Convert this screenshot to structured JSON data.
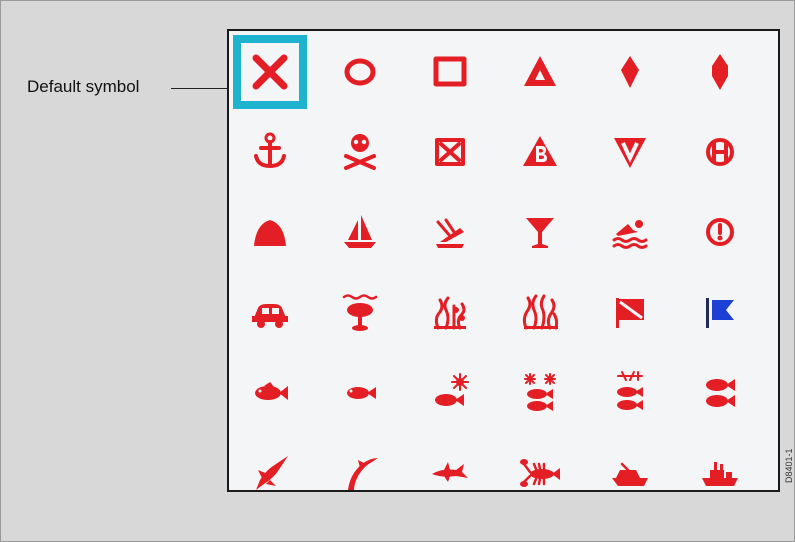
{
  "callout": {
    "label": "Default symbol"
  },
  "figure_code": "D8401-1",
  "symbol_grid": {
    "rows": [
      [
        "x-mark",
        "circle",
        "square",
        "triangle",
        "diamond",
        "diamond-tall"
      ],
      [
        "anchor",
        "skull-crossbones",
        "boxed-x",
        "triangle-b",
        "triangle-down-v",
        "circle-h"
      ],
      [
        "rock",
        "sailboat",
        "wreck",
        "cocktail",
        "swimmer",
        "circle-exclamation"
      ],
      [
        "car",
        "palm-tree",
        "seaweed",
        "kelp",
        "dive-flag",
        "alpha-flag"
      ],
      [
        "fish",
        "fish-small",
        "fish-sun",
        "two-fish-stars",
        "two-fish-sun",
        "two-fish"
      ],
      [
        "marlin",
        "dolphin",
        "shark",
        "lobster",
        "powerboat",
        "ship"
      ]
    ],
    "selected": "x-mark"
  }
}
